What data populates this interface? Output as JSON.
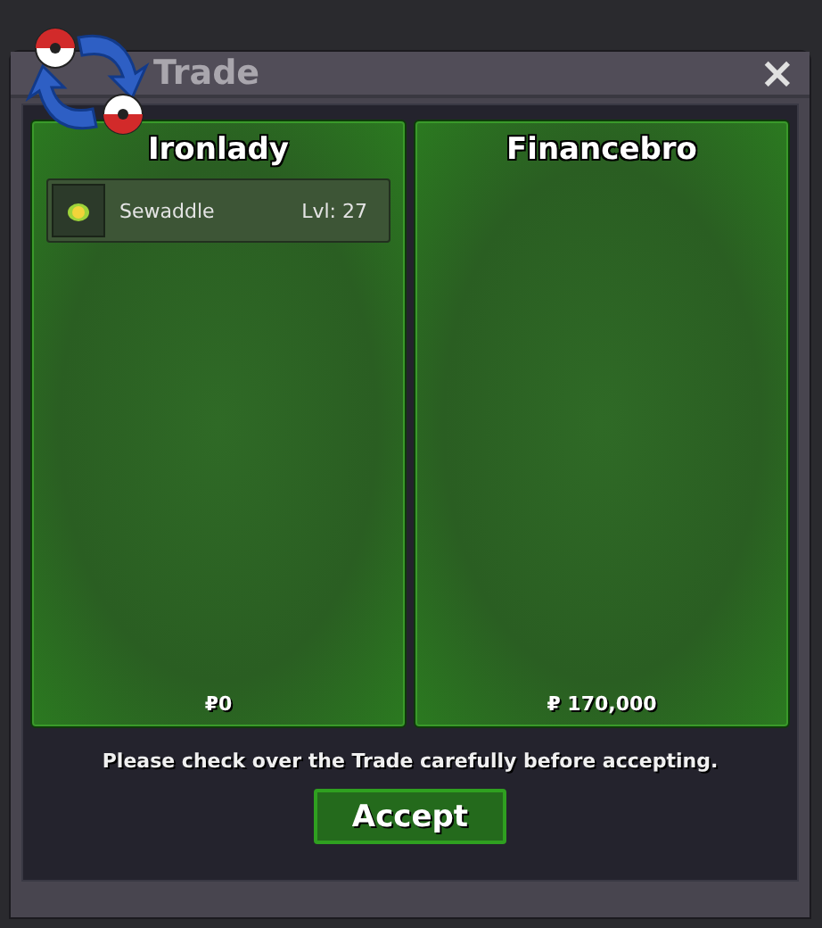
{
  "window": {
    "title": "Trade",
    "close": "×"
  },
  "traders": [
    {
      "name": "Ironlady",
      "items": [
        {
          "name": "Sewaddle",
          "level": "Lvl: 27"
        }
      ],
      "money": "₽0"
    },
    {
      "name": "Financebro",
      "money": "₽ 170,000"
    }
  ],
  "notice": "Please check over the Trade carefully before accepting.",
  "accept_button": "Accept"
}
